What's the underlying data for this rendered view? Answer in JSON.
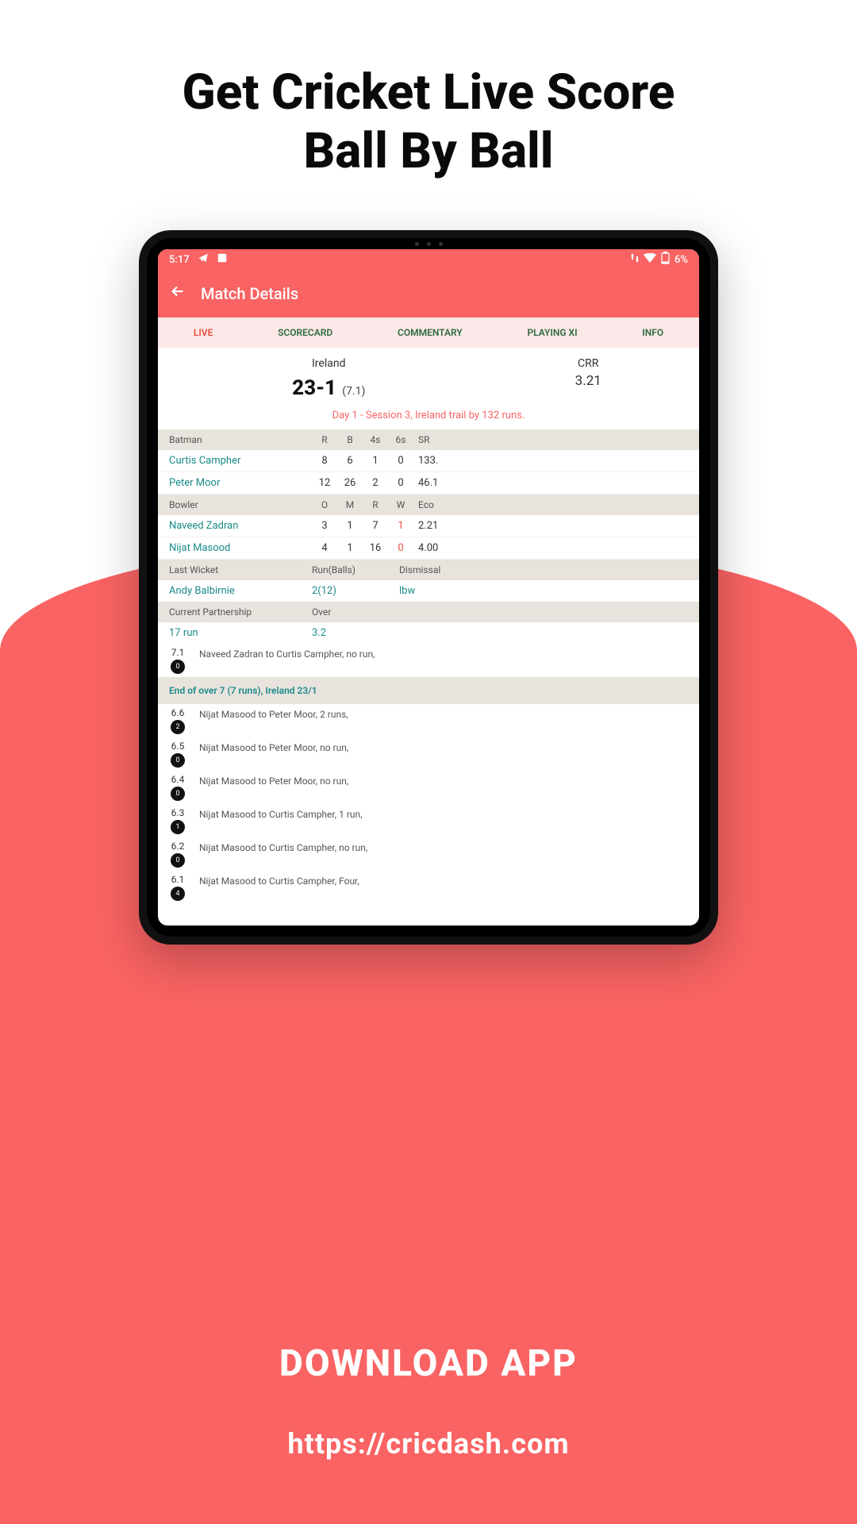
{
  "promo": {
    "title_line1": "Get Cricket Live Score",
    "title_line2": "Ball By Ball",
    "download": "DOWNLOAD APP",
    "website": "https://cricdash.com"
  },
  "status_bar": {
    "time": "5:17",
    "battery": "6%"
  },
  "header": {
    "title": "Match Details"
  },
  "tabs": {
    "live": "LIVE",
    "scorecard": "SCORECARD",
    "commentary": "COMMENTARY",
    "playing_xi": "PLAYING XI",
    "info": "INFO"
  },
  "score": {
    "team": "Ireland",
    "runs_wkts": "23-1",
    "overs": "(7.1)",
    "crr_label": "CRR",
    "crr_value": "3.21",
    "status": "Day 1 - Session 3, Ireland trail by 132 runs."
  },
  "batsmen": {
    "h_name": "Batman",
    "h_r": "R",
    "h_b": "B",
    "h_4s": "4s",
    "h_6s": "6s",
    "h_sr": "SR",
    "rows": [
      {
        "name": "Curtis Campher",
        "r": "8",
        "b": "6",
        "fours": "1",
        "sixes": "0",
        "sr": "133."
      },
      {
        "name": "Peter Moor",
        "r": "12",
        "b": "26",
        "fours": "2",
        "sixes": "0",
        "sr": "46.1"
      }
    ]
  },
  "bowlers": {
    "h_name": "Bowler",
    "h_o": "O",
    "h_m": "M",
    "h_r": "R",
    "h_w": "W",
    "h_eco": "Eco",
    "rows": [
      {
        "name": "Naveed Zadran",
        "o": "3",
        "m": "1",
        "r": "7",
        "w": "1",
        "eco": "2.21"
      },
      {
        "name": "Nijat Masood",
        "o": "4",
        "m": "1",
        "r": "16",
        "w": "0",
        "eco": "4.00"
      }
    ]
  },
  "last_wicket": {
    "h1": "Last Wicket",
    "h2": "Run(Balls)",
    "h3": "Dismissal",
    "name": "Andy Balbirnie",
    "runs_balls": "2(12)",
    "dismissal": "lbw"
  },
  "partnership": {
    "h1": "Current Partnership",
    "h2": "Over",
    "runs": "17 run",
    "overs": "3.2"
  },
  "commentary": {
    "over_end": "End of over 7 (7 runs), Ireland 23/1",
    "balls": [
      {
        "over": "7.1",
        "badge": "0",
        "text": "Naveed Zadran to Curtis Campher, no run,"
      },
      {
        "over": "6.6",
        "badge": "2",
        "text": "Nijat Masood to Peter Moor, 2 runs,"
      },
      {
        "over": "6.5",
        "badge": "0",
        "text": "Nijat Masood to Peter Moor, no run,"
      },
      {
        "over": "6.4",
        "badge": "0",
        "text": "Nijat Masood to Peter Moor, no run,"
      },
      {
        "over": "6.3",
        "badge": "1",
        "text": "Nijat Masood to Curtis Campher, 1 run,"
      },
      {
        "over": "6.2",
        "badge": "0",
        "text": "Nijat Masood to Curtis Campher, no run,"
      },
      {
        "over": "6.1",
        "badge": "4",
        "text": "Nijat Masood to Curtis Campher, Four,"
      }
    ]
  }
}
